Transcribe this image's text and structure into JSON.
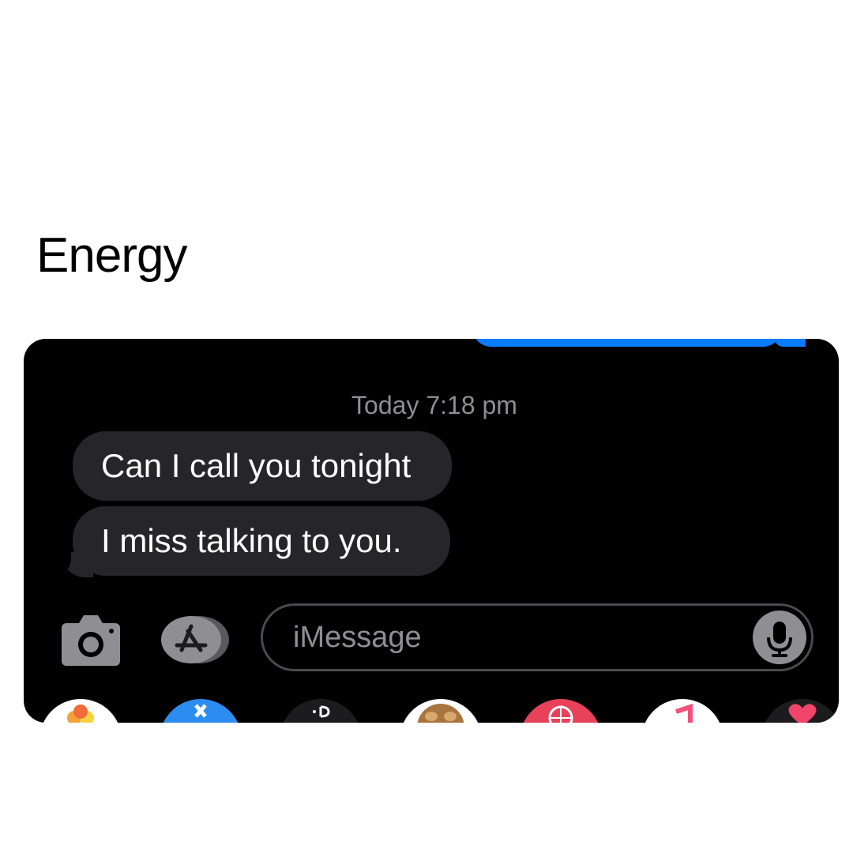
{
  "caption": "Energy",
  "thread": {
    "timestamp": "Today 7:18 pm",
    "messages": [
      {
        "text": "Can I call you tonight"
      },
      {
        "text": "I miss talking to you."
      }
    ]
  },
  "composer": {
    "placeholder": "iMessage"
  },
  "icons": {
    "camera": "camera-icon",
    "apps": "app-store-icon",
    "mic": "microphone-icon"
  },
  "app_drawer": [
    "photos-app",
    "app-store-app",
    "digital-touch-app",
    "animoji-app",
    "search-app",
    "music-app",
    "hearts-app"
  ],
  "colors": {
    "accent": "#0a7cff",
    "received_bubble": "#26252a",
    "background": "#000000",
    "timestamp": "#8e8e93"
  }
}
